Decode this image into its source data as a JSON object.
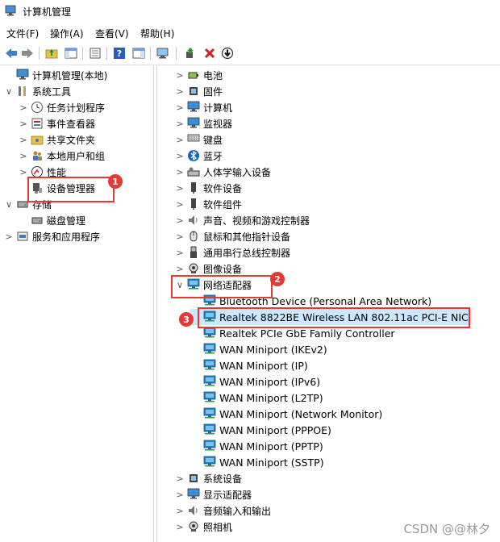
{
  "window": {
    "title": "计算机管理"
  },
  "menu": [
    "文件(F)",
    "操作(A)",
    "查看(V)",
    "帮助(H)"
  ],
  "left_tree": [
    {
      "label": "计算机管理(本地)",
      "icon": "computer-management-icon",
      "expander": ""
    },
    {
      "label": "系统工具",
      "icon": "tools-icon",
      "expander": "∨"
    },
    {
      "label": "任务计划程序",
      "icon": "clock-icon",
      "expander": ">"
    },
    {
      "label": "事件查看器",
      "icon": "event-viewer-icon",
      "expander": ">"
    },
    {
      "label": "共享文件夹",
      "icon": "shared-folder-icon",
      "expander": ">"
    },
    {
      "label": "本地用户和组",
      "icon": "users-icon",
      "expander": ">"
    },
    {
      "label": "性能",
      "icon": "performance-icon",
      "expander": ">"
    },
    {
      "label": "设备管理器",
      "icon": "device-manager-icon",
      "expander": ""
    },
    {
      "label": "存储",
      "icon": "storage-icon",
      "expander": "∨"
    },
    {
      "label": "磁盘管理",
      "icon": "disk-icon",
      "expander": ""
    },
    {
      "label": "服务和应用程序",
      "icon": "services-icon",
      "expander": ">"
    }
  ],
  "right_tree": [
    {
      "label": "电池",
      "icon": "battery-icon",
      "expander": ">",
      "level": 0
    },
    {
      "label": "固件",
      "icon": "firmware-icon",
      "expander": ">",
      "level": 0
    },
    {
      "label": "计算机",
      "icon": "computer-icon",
      "expander": ">",
      "level": 0
    },
    {
      "label": "监视器",
      "icon": "monitor-icon",
      "expander": ">",
      "level": 0
    },
    {
      "label": "键盘",
      "icon": "keyboard-icon",
      "expander": ">",
      "level": 0
    },
    {
      "label": "蓝牙",
      "icon": "bluetooth-icon",
      "expander": ">",
      "level": 0
    },
    {
      "label": "人体学输入设备",
      "icon": "hid-icon",
      "expander": ">",
      "level": 0
    },
    {
      "label": "软件设备",
      "icon": "software-device-icon",
      "expander": ">",
      "level": 0
    },
    {
      "label": "软件组件",
      "icon": "software-component-icon",
      "expander": ">",
      "level": 0
    },
    {
      "label": "声音、视频和游戏控制器",
      "icon": "speaker-icon",
      "expander": ">",
      "level": 0
    },
    {
      "label": "鼠标和其他指针设备",
      "icon": "mouse-icon",
      "expander": ">",
      "level": 0
    },
    {
      "label": "通用串行总线控制器",
      "icon": "usb-icon",
      "expander": ">",
      "level": 0
    },
    {
      "label": "图像设备",
      "icon": "camera-icon",
      "expander": ">",
      "level": 0
    },
    {
      "label": "网络适配器",
      "icon": "network-adapter-icon",
      "expander": "∨",
      "level": 0
    },
    {
      "label": "Bluetooth Device (Personal Area Network)",
      "icon": "network-adapter-icon",
      "expander": "",
      "level": 1
    },
    {
      "label": "Realtek 8822BE Wireless LAN 802.11ac PCI-E NIC",
      "icon": "network-adapter-icon",
      "expander": "",
      "level": 1
    },
    {
      "label": "Realtek PCIe GbE Family Controller",
      "icon": "network-adapter-icon",
      "expander": "",
      "level": 1
    },
    {
      "label": "WAN Miniport (IKEv2)",
      "icon": "network-adapter-icon",
      "expander": "",
      "level": 1
    },
    {
      "label": "WAN Miniport (IP)",
      "icon": "network-adapter-icon",
      "expander": "",
      "level": 1
    },
    {
      "label": "WAN Miniport (IPv6)",
      "icon": "network-adapter-icon",
      "expander": "",
      "level": 1
    },
    {
      "label": "WAN Miniport (L2TP)",
      "icon": "network-adapter-icon",
      "expander": "",
      "level": 1
    },
    {
      "label": "WAN Miniport (Network Monitor)",
      "icon": "network-adapter-icon",
      "expander": "",
      "level": 1
    },
    {
      "label": "WAN Miniport (PPPOE)",
      "icon": "network-adapter-icon",
      "expander": "",
      "level": 1
    },
    {
      "label": "WAN Miniport (PPTP)",
      "icon": "network-adapter-icon",
      "expander": "",
      "level": 1
    },
    {
      "label": "WAN Miniport (SSTP)",
      "icon": "network-adapter-icon",
      "expander": "",
      "level": 1
    },
    {
      "label": "系统设备",
      "icon": "system-device-icon",
      "expander": ">",
      "level": 0
    },
    {
      "label": "显示适配器",
      "icon": "display-adapter-icon",
      "expander": ">",
      "level": 0
    },
    {
      "label": "音频输入和输出",
      "icon": "audio-icon",
      "expander": ">",
      "level": 0
    },
    {
      "label": "照相机",
      "icon": "webcam-icon",
      "expander": ">",
      "level": 0
    }
  ],
  "callouts": [
    "1",
    "2",
    "3"
  ],
  "watermark": "CSDN @@林夕",
  "colors": {
    "callout": "#e53935",
    "selection": "#cce8ff",
    "adapter_icon": "#1e88c8"
  }
}
